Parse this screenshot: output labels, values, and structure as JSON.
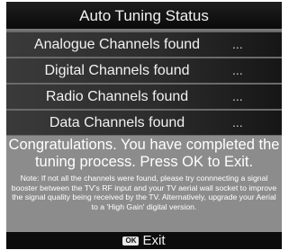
{
  "title": "Auto Tuning Status",
  "results": [
    {
      "label": "Analogue  Channels found",
      "value": "..."
    },
    {
      "label": "Digital Channels found",
      "value": "..."
    },
    {
      "label": "Radio Channels found",
      "value": "..."
    },
    {
      "label": "Data Channels found",
      "value": "..."
    }
  ],
  "message": {
    "congrats": "Congratulations. You have completed the tuning process. Press OK to Exit.",
    "note": "Note: If not all the channels were found, please try connnecting a signal booster between the TV's RF input and your TV aerial wall socket to improve the signal quality being received by the TV. Alternatively, upgrade your Aerial to a 'High Gain' digital version."
  },
  "footer": {
    "key_icon": "ok-key-icon",
    "key_label": "OK",
    "action_label": "Exit"
  },
  "colors": {
    "title_bar": "#0a0a0a",
    "row_background": "#2c2c2c",
    "info_panel": "#8c8c8c",
    "footer": "#0c0c0c",
    "text": "#ffffff"
  }
}
